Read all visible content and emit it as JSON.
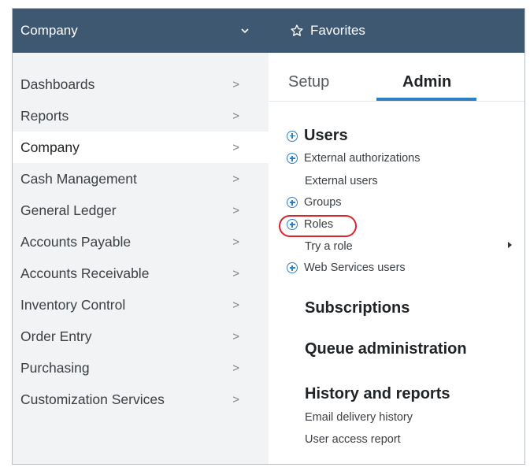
{
  "left_menu": {
    "header_title": "Company",
    "items": [
      {
        "label": "Dashboards",
        "chevron": ">"
      },
      {
        "label": "Reports",
        "chevron": ">"
      },
      {
        "label": "Company",
        "chevron": ">"
      },
      {
        "label": "Cash Management",
        "chevron": ">"
      },
      {
        "label": "General Ledger",
        "chevron": ">"
      },
      {
        "label": "Accounts Payable",
        "chevron": ">"
      },
      {
        "label": "Accounts Receivable",
        "chevron": ">"
      },
      {
        "label": "Inventory Control",
        "chevron": ">"
      },
      {
        "label": "Order Entry",
        "chevron": ">"
      },
      {
        "label": "Purchasing",
        "chevron": ">"
      },
      {
        "label": "Customization Services",
        "chevron": ">"
      }
    ]
  },
  "right_panel": {
    "header_title": "Favorites",
    "tabs": [
      {
        "label": "Setup"
      },
      {
        "label": "Admin"
      }
    ],
    "users": {
      "heading": "Users",
      "external_authorizations": "External authorizations",
      "external_users": "External users",
      "groups": "Groups",
      "roles": "Roles",
      "try_a_role": "Try a role",
      "web_services_users": "Web Services users"
    },
    "subscriptions": "Subscriptions",
    "queue_administration": "Queue administration",
    "history": {
      "heading": "History and reports",
      "email_delivery_history": "Email delivery history",
      "user_access_report": "User access report"
    }
  },
  "colors": {
    "header_bg": "#3f5872",
    "accent": "#2f7fc1",
    "highlight_ring": "#d9232e"
  }
}
